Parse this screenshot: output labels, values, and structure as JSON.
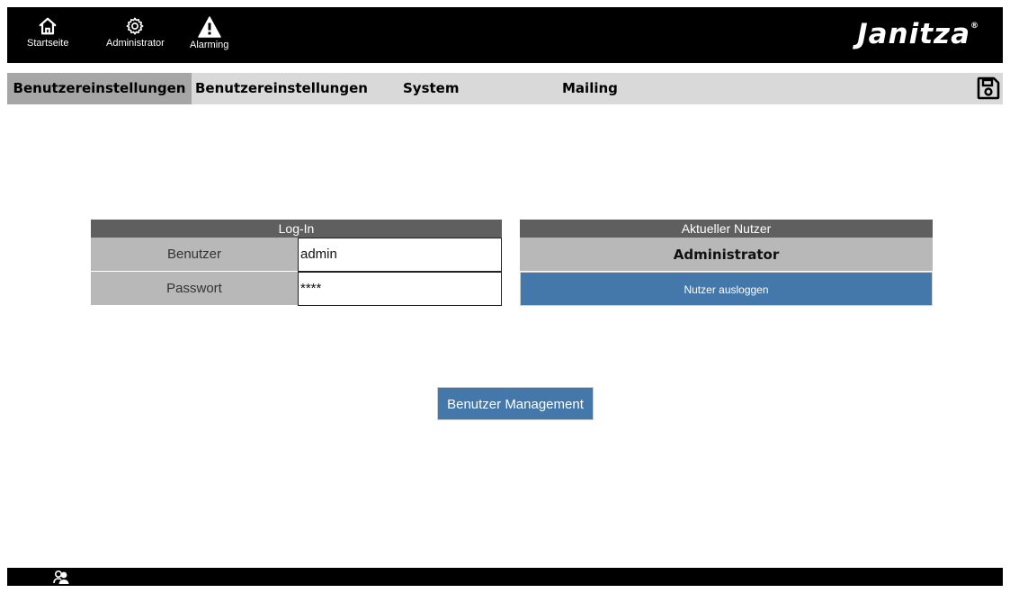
{
  "topbar": {
    "nav": [
      {
        "label": "Startseite",
        "icon": "home-icon"
      },
      {
        "label": "Administrator",
        "icon": "gear-icon"
      },
      {
        "label": "Alarming",
        "icon": "warning-icon"
      }
    ],
    "logo": "Janitza",
    "logo_mark": "®"
  },
  "tabs": [
    {
      "label": "Benutzereinstellungen",
      "active": true
    },
    {
      "label": "Benutzereinstellungen",
      "active": false
    },
    {
      "label": "System",
      "active": false
    },
    {
      "label": "Mailing",
      "active": false
    }
  ],
  "login": {
    "header": "Log-In",
    "user_label": "Benutzer",
    "user_value": "admin",
    "password_label": "Passwort",
    "password_value": "****"
  },
  "current_user": {
    "header": "Aktueller Nutzer",
    "name": "Administrator",
    "logout_label": "Nutzer ausloggen"
  },
  "user_management_label": "Benutzer Management",
  "colors": {
    "bar": "#000000",
    "tab_bar": "#d9d9d9",
    "tab_active": "#a6a6a6",
    "panel_header": "#5f5f5f",
    "row_label": "#b8b8b8",
    "button": "#4477aa"
  }
}
